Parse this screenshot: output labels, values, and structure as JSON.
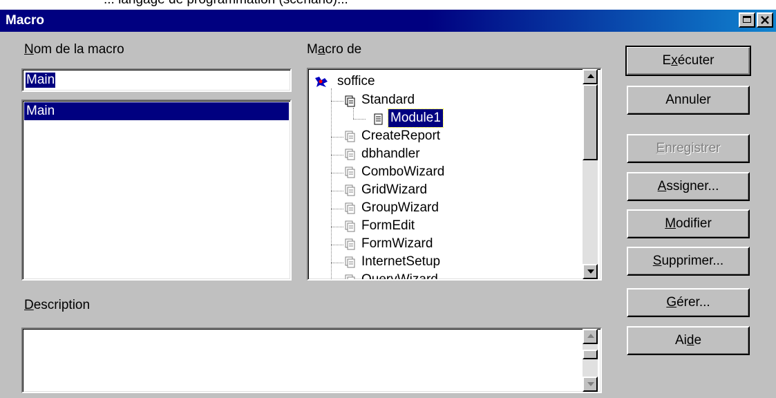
{
  "caption_fragment": "... langage de programmation (scénario)...",
  "window": {
    "title": "Macro"
  },
  "labels": {
    "macro_name_pre": "",
    "macro_name_mn": "N",
    "macro_name_rest": "om de la macro",
    "macro_from_pre": "M",
    "macro_from_mn": "a",
    "macro_from_rest": "cro de",
    "description_mn": "D",
    "description_rest": "escription"
  },
  "macro_name_input": {
    "value": "Main"
  },
  "macro_list": {
    "items": [
      "Main"
    ],
    "selected": "Main"
  },
  "tree": {
    "root": "soffice",
    "library": "Standard",
    "module": "Module1",
    "libraries": [
      "CreateReport",
      "dbhandler",
      "ComboWizard",
      "GridWizard",
      "GroupWizard",
      "FormEdit",
      "FormWizard",
      "InternetSetup",
      "QueryWizard"
    ]
  },
  "buttons": {
    "execute_pre": "E",
    "execute_mn": "x",
    "execute_rest": "écuter",
    "cancel": "Annuler",
    "save_mn": "E",
    "save_rest": "nregistrer",
    "assign_mn": "A",
    "assign_rest": "ssigner...",
    "modify_mn": "M",
    "modify_rest": "odifier",
    "delete_mn": "S",
    "delete_rest": "upprimer...",
    "manage_pre": "",
    "manage_mn": "G",
    "manage_rest": "érer...",
    "help_pre": "Ai",
    "help_mn": "d",
    "help_rest": "e"
  },
  "description_value": ""
}
